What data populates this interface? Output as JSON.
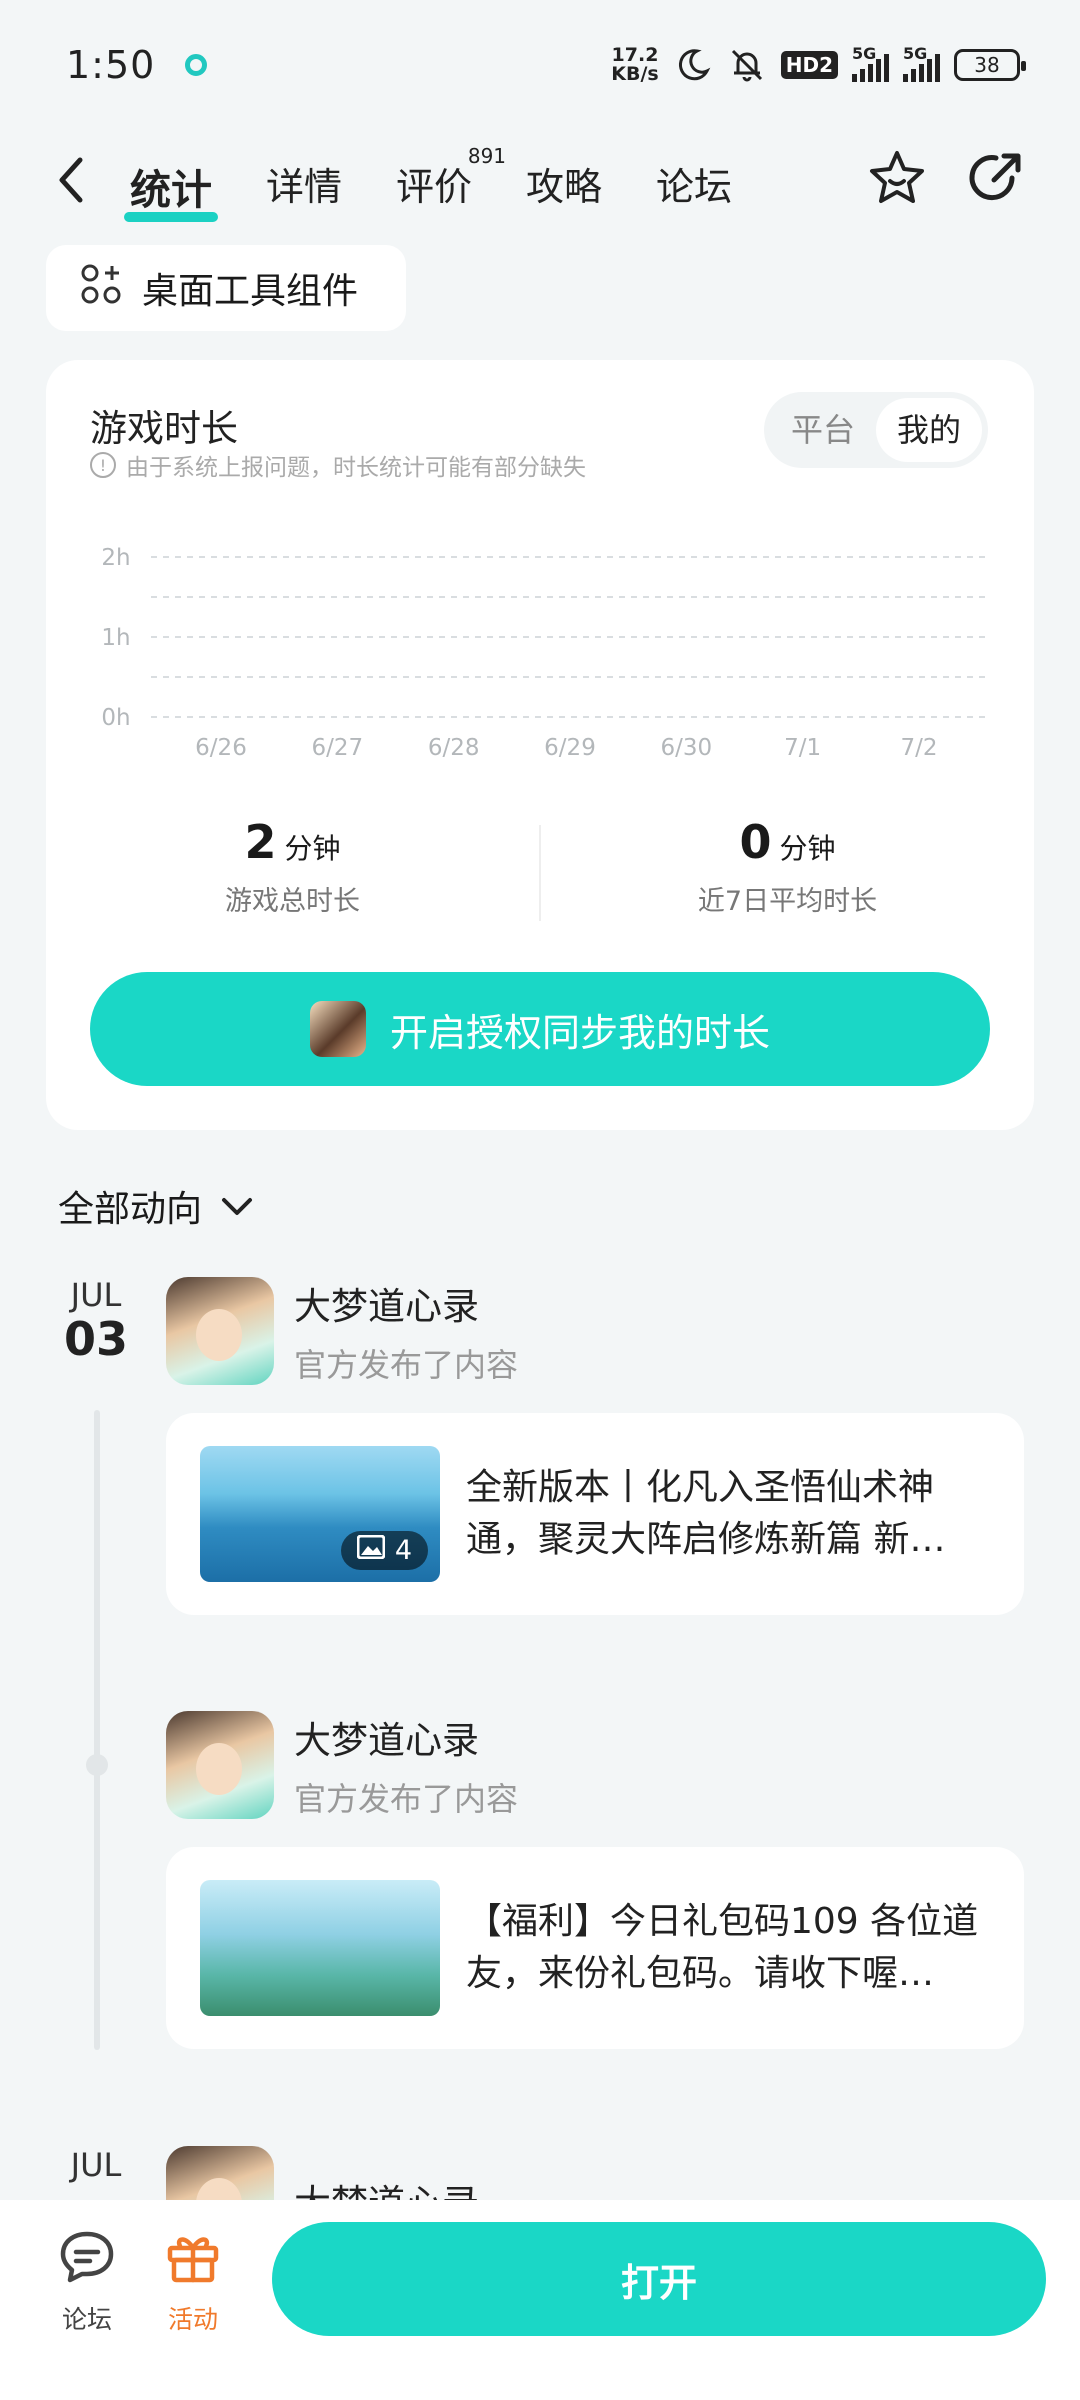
{
  "status_bar": {
    "time": "1:50",
    "net_speed_value": "17.2",
    "net_speed_unit": "KB/s",
    "hd_label": "HD2",
    "network_1": "5G",
    "network_2": "5G",
    "battery": "38"
  },
  "nav": {
    "tabs": [
      {
        "label": "统计",
        "active": true
      },
      {
        "label": "详情"
      },
      {
        "label": "评价",
        "badge": "891"
      },
      {
        "label": "攻略"
      },
      {
        "label": "论坛"
      }
    ]
  },
  "widget_button": {
    "label": "桌面工具组件"
  },
  "playtime_card": {
    "title": "游戏时长",
    "note": "由于系统上报问题，时长统计可能有部分缺失",
    "toggle": [
      "平台",
      "我的"
    ],
    "toggle_selected": "我的"
  },
  "chart_data": {
    "type": "line",
    "categories": [
      "6/26",
      "6/27",
      "6/28",
      "6/29",
      "6/30",
      "7/1",
      "7/2"
    ],
    "y_ticks": [
      "2h",
      "1h",
      "0h"
    ],
    "ylim": [
      0,
      2
    ],
    "grid": true,
    "series": [
      {
        "values": [
          0,
          0,
          0,
          0,
          0,
          0,
          0
        ]
      }
    ]
  },
  "stats": [
    {
      "value": "2",
      "unit": "分钟",
      "label": "游戏总时长"
    },
    {
      "value": "0",
      "unit": "分钟",
      "label": "近7日平均时长"
    }
  ],
  "auth_button": {
    "label": "开启授权同步我的时长"
  },
  "feed": {
    "filter_label": "全部动向",
    "date": {
      "month": "JUL",
      "day": "03"
    },
    "date2": {
      "month": "JUL"
    },
    "items": [
      {
        "app_name": "大梦道心录",
        "action": "官方发布了内容",
        "image_count": "4",
        "post_text": "全新版本丨化凡入圣悟仙术神通，聚灵大阵启修炼新篇 新…"
      },
      {
        "app_name": "大梦道心录",
        "action": "官方发布了内容",
        "post_text": "【福利】今日礼包码109 各位道友，来份礼包码。请收下喔…"
      },
      {
        "app_name": "大梦道心录"
      }
    ]
  },
  "bottom_bar": {
    "forum_label": "论坛",
    "activity_label": "活动",
    "open_label": "打开",
    "accent": "#1ad7c6",
    "activity_color": "#f07a2c"
  }
}
